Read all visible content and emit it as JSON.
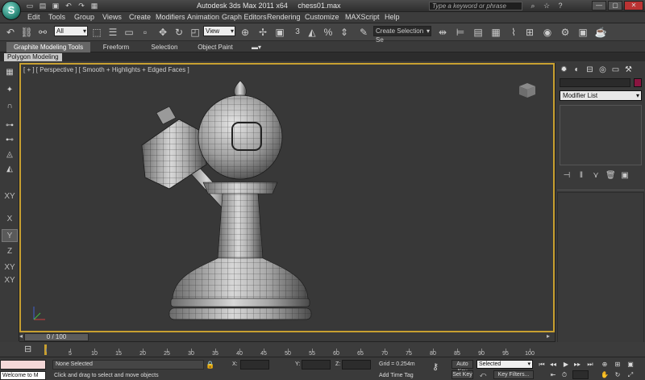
{
  "titlebar": {
    "app_logo": "S",
    "app_title": "Autodesk 3ds Max  2011 x64",
    "file_name": "chess01.max",
    "search_placeholder": "Type a keyword or phrase",
    "quick_access": [
      "new-icon",
      "open-icon",
      "save-icon",
      "undo-icon",
      "redo-icon",
      "hold-icon"
    ]
  },
  "menu": {
    "items": [
      "Edit",
      "Tools",
      "Group",
      "Views",
      "Create",
      "Modifiers",
      "Animation",
      "Graph Editors",
      "Rendering",
      "Customize",
      "MAXScript",
      "Help"
    ]
  },
  "main_toolbar": {
    "selection_filter": "All",
    "ref_coord": "View",
    "named_selection": "Create Selection Se",
    "snap_label": "3"
  },
  "ribbon": {
    "tabs": [
      "Graphite Modeling Tools",
      "Freeform",
      "Selection",
      "Object Paint"
    ],
    "active_tab": "Graphite Modeling Tools",
    "panel_label": "Polygon Modeling"
  },
  "left_toolbar": {
    "axis_labels": [
      "XY",
      "X",
      "Y",
      "Z",
      "XY",
      "XY"
    ]
  },
  "viewport": {
    "label": "[ + ] [ Perspective ] [ Smooth + Highlights + Edged Faces ]",
    "active_border_color": "#c8a030"
  },
  "command_panel": {
    "modifier_list": "Modifier List",
    "object_color": "#8a1540"
  },
  "time_slider": {
    "label": "0 / 100"
  },
  "track_bar": {
    "ticks": [
      "0",
      "5",
      "10",
      "15",
      "20",
      "25",
      "30",
      "35",
      "40",
      "45",
      "50",
      "55",
      "60",
      "65",
      "70",
      "75",
      "80",
      "85",
      "90",
      "95",
      "100"
    ]
  },
  "status": {
    "selection": "None Selected",
    "prompt": "Click and drag to select and move objects",
    "x_label": "X:",
    "y_label": "Y:",
    "z_label": "Z:",
    "grid": "Grid = 0.254m",
    "add_time_tag": "Add Time Tag",
    "auto_key": "Auto Key",
    "set_key": "Set Key",
    "selected_dropdown": "Selected",
    "key_filters": "Key Filters...",
    "welcome": "Welcome to M"
  }
}
